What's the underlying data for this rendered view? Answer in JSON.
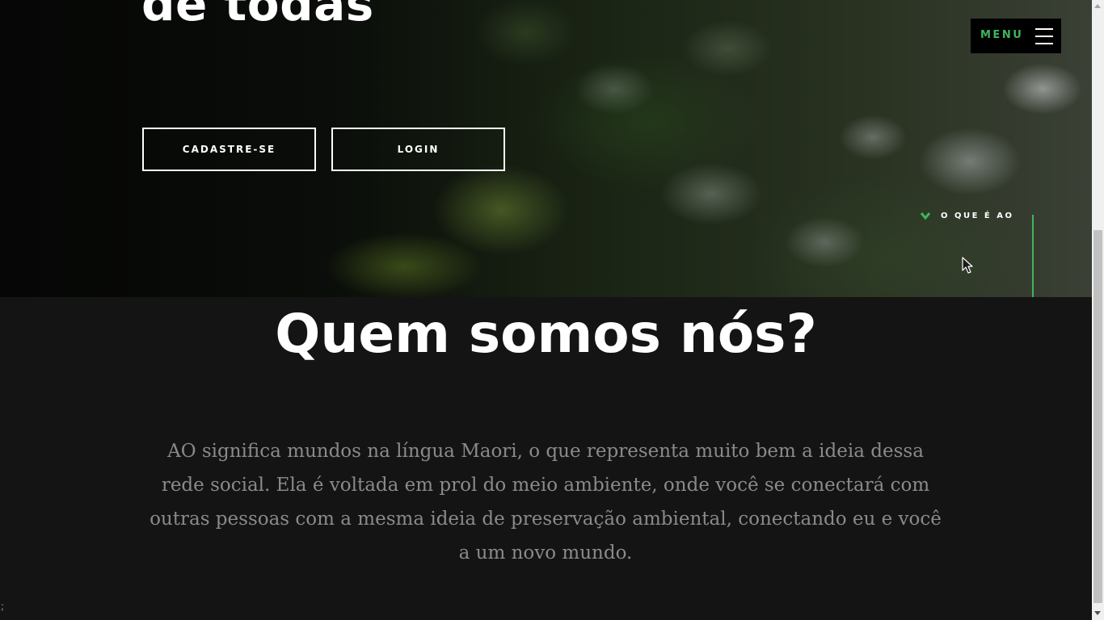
{
  "hero": {
    "heading": "de todas",
    "register_button": "CADASTRE-SE",
    "login_button": "LOGIN",
    "scroll_link": "O QUE É AO",
    "chevron_icon": "chevron-down-icon"
  },
  "nav": {
    "menu_label": "MENU",
    "menu_icon": "hamburger-icon"
  },
  "about": {
    "title": "Quem somos nós?",
    "text": "AO significa mundos na língua Maori, o que representa muito bem a ideia dessa rede social. Ela é voltada em prol do meio ambiente, onde você se conectará com outras pessoas com a mesma ideia de preservação ambiental, conectando eu e você a um novo mundo.",
    "stray": ";"
  },
  "colors": {
    "accent": "#3fb55a",
    "background": "#141414",
    "body_text": "#8a8a8a"
  }
}
